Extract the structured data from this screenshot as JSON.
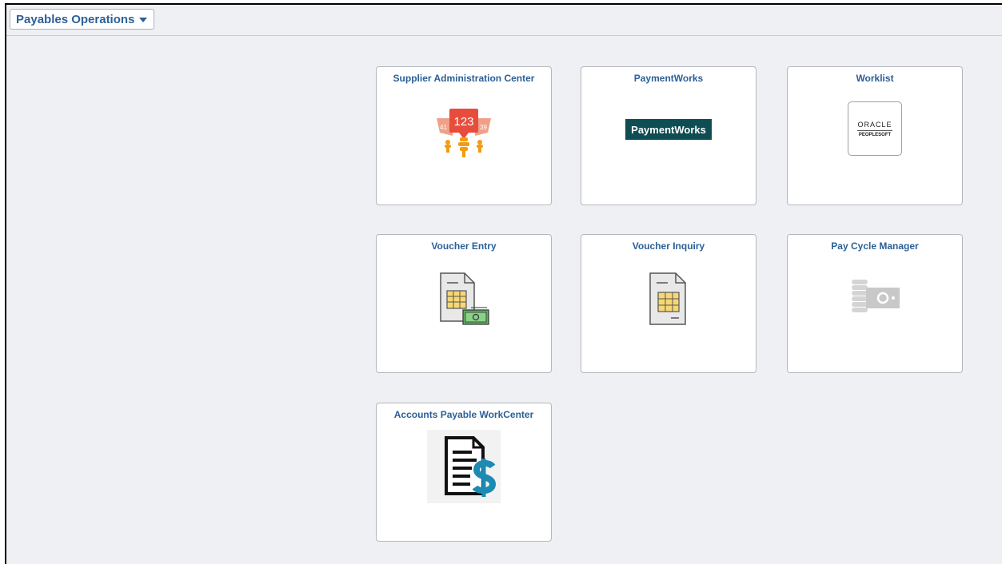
{
  "header": {
    "page_title": "Payables Operations"
  },
  "tiles": [
    {
      "title": "Supplier Administration Center",
      "badge": "123",
      "side_left": "41",
      "side_right": "39"
    },
    {
      "title": "PaymentWorks",
      "logo_text": "PaymentWorks"
    },
    {
      "title": "Worklist",
      "logo_line1": "ORACLE",
      "logo_line2": "PEOPLESOFT"
    },
    {
      "title": "Voucher Entry"
    },
    {
      "title": "Voucher Inquiry"
    },
    {
      "title": "Pay Cycle Manager"
    },
    {
      "title": "Accounts Payable WorkCenter"
    }
  ],
  "colors": {
    "accent": "#2b5f97",
    "background": "#eff0f3",
    "paymentworks_bg": "#0f4d54"
  },
  "icons": [
    "dropdown-caret-icon",
    "supplier-admin-icon",
    "paymentworks-logo",
    "oracle-peoplesoft-logo",
    "voucher-entry-icon",
    "voucher-inquiry-icon",
    "pay-cycle-icon",
    "ap-workcenter-icon"
  ]
}
